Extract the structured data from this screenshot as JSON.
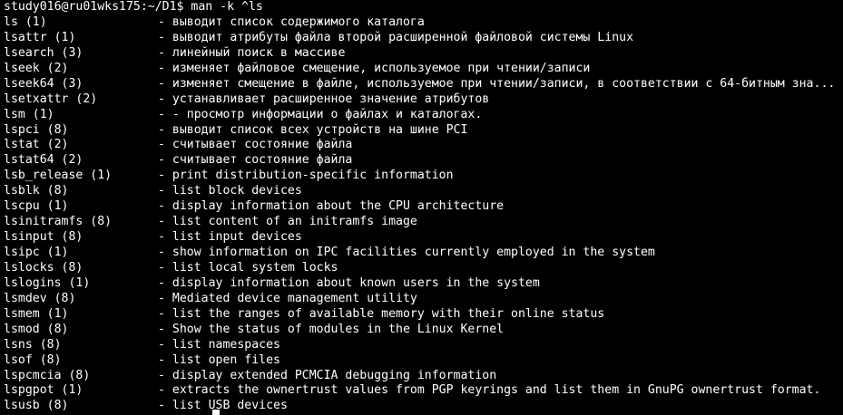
{
  "terminal": {
    "prompt": "study016@ru01wks175:~/D1$ man -k ^ls",
    "entries": [
      {
        "name": "ls (1)",
        "desc": "- выводит список содержимого каталога"
      },
      {
        "name": "lsattr (1)",
        "desc": "- выводит атрибуты файла второй расширенной файловой системы Linux"
      },
      {
        "name": "lsearch (3)",
        "desc": "- линейный поиск в массиве"
      },
      {
        "name": "lseek (2)",
        "desc": "- изменяет файловое смещение, используемое при чтении/записи"
      },
      {
        "name": "lseek64 (3)",
        "desc": "- изменяет смещение в файле, используемое при чтении/записи, в соответствии с 64-битным зна..."
      },
      {
        "name": "lsetxattr (2)",
        "desc": "- устанавливает расширенное значение атрибутов"
      },
      {
        "name": "lsm (1)",
        "desc": "- - просмотр информации о файлах и каталогах."
      },
      {
        "name": "lspci (8)",
        "desc": "- выводит список всех устройств на шине PCI"
      },
      {
        "name": "lstat (2)",
        "desc": "- считывает состояние файла"
      },
      {
        "name": "lstat64 (2)",
        "desc": "- считывает состояние файла"
      },
      {
        "name": "lsb_release (1)",
        "desc": "- print distribution-specific information"
      },
      {
        "name": "lsblk (8)",
        "desc": "- list block devices"
      },
      {
        "name": "lscpu (1)",
        "desc": "- display information about the CPU architecture"
      },
      {
        "name": "lsinitramfs (8)",
        "desc": "- list content of an initramfs image"
      },
      {
        "name": "lsinput (8)",
        "desc": "- list input devices"
      },
      {
        "name": "lsipc (1)",
        "desc": "- show information on IPC facilities currently employed in the system"
      },
      {
        "name": "lslocks (8)",
        "desc": "- list local system locks"
      },
      {
        "name": "lslogins (1)",
        "desc": "- display information about known users in the system"
      },
      {
        "name": "lsmdev (8)",
        "desc": "- Mediated device management utility"
      },
      {
        "name": "lsmem (1)",
        "desc": "- list the ranges of available memory with their online status"
      },
      {
        "name": "lsmod (8)",
        "desc": "- Show the status of modules in the Linux Kernel"
      },
      {
        "name": "lsns (8)",
        "desc": "- list namespaces"
      },
      {
        "name": "lsof (8)",
        "desc": "- list open files"
      },
      {
        "name": "lspcmcia (8)",
        "desc": "- display extended PCMCIA debugging information"
      },
      {
        "name": "lspgpot (1)",
        "desc": "- extracts the ownertrust values from PGP keyrings and list them in GnuPG ownertrust format."
      },
      {
        "name": "lsusb (8)",
        "desc": "- list USB devices"
      }
    ]
  },
  "colors": {
    "background": "#000000",
    "foreground": "#ffffff"
  }
}
